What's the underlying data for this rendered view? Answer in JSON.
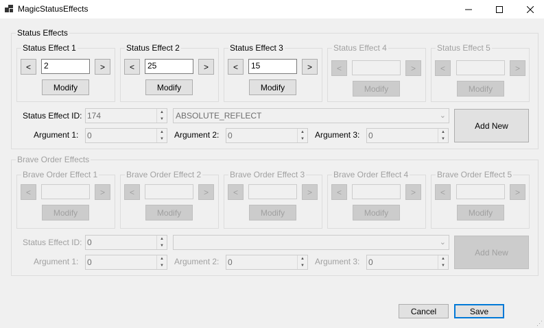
{
  "window": {
    "title": "MagicStatusEffects"
  },
  "status_effects": {
    "title": "Status Effects",
    "slots": [
      {
        "title": "Status Effect 1",
        "value": "2",
        "prev": "<",
        "next": ">",
        "modify": "Modify",
        "enabled": true
      },
      {
        "title": "Status Effect 2",
        "value": "25",
        "prev": "<",
        "next": ">",
        "modify": "Modify",
        "enabled": true
      },
      {
        "title": "Status Effect 3",
        "value": "15",
        "prev": "<",
        "next": ">",
        "modify": "Modify",
        "enabled": true
      },
      {
        "title": "Status Effect 4",
        "value": "",
        "prev": "<",
        "next": ">",
        "modify": "Modify",
        "enabled": false
      },
      {
        "title": "Status Effect 5",
        "value": "",
        "prev": "<",
        "next": ">",
        "modify": "Modify",
        "enabled": false
      }
    ],
    "id_label": "Status Effect ID:",
    "id_value": "174",
    "effect_name": "ABSOLUTE_REFLECT",
    "arg1_label": "Argument 1:",
    "arg1_value": "0",
    "arg2_label": "Argument 2:",
    "arg2_value": "0",
    "arg3_label": "Argument 3:",
    "arg3_value": "0",
    "add_new": "Add New"
  },
  "brave_order": {
    "title": "Brave Order Effects",
    "slots": [
      {
        "title": "Brave Order Effect 1",
        "value": "",
        "prev": "<",
        "next": ">",
        "modify": "Modify"
      },
      {
        "title": "Brave Order Effect 2",
        "value": "",
        "prev": "<",
        "next": ">",
        "modify": "Modify"
      },
      {
        "title": "Brave Order Effect 3",
        "value": "",
        "prev": "<",
        "next": ">",
        "modify": "Modify"
      },
      {
        "title": "Brave Order Effect 4",
        "value": "",
        "prev": "<",
        "next": ">",
        "modify": "Modify"
      },
      {
        "title": "Brave Order Effect 5",
        "value": "",
        "prev": "<",
        "next": ">",
        "modify": "Modify"
      }
    ],
    "id_label": "Status Effect ID:",
    "id_value": "0",
    "effect_name": "",
    "arg1_label": "Argument 1:",
    "arg1_value": "0",
    "arg2_label": "Argument 2:",
    "arg2_value": "0",
    "arg3_label": "Argument 3:",
    "arg3_value": "0",
    "add_new": "Add New"
  },
  "footer": {
    "cancel": "Cancel",
    "save": "Save"
  },
  "icons": {
    "minimize": "minimize-icon",
    "maximize": "maximize-icon",
    "close": "close-icon"
  }
}
